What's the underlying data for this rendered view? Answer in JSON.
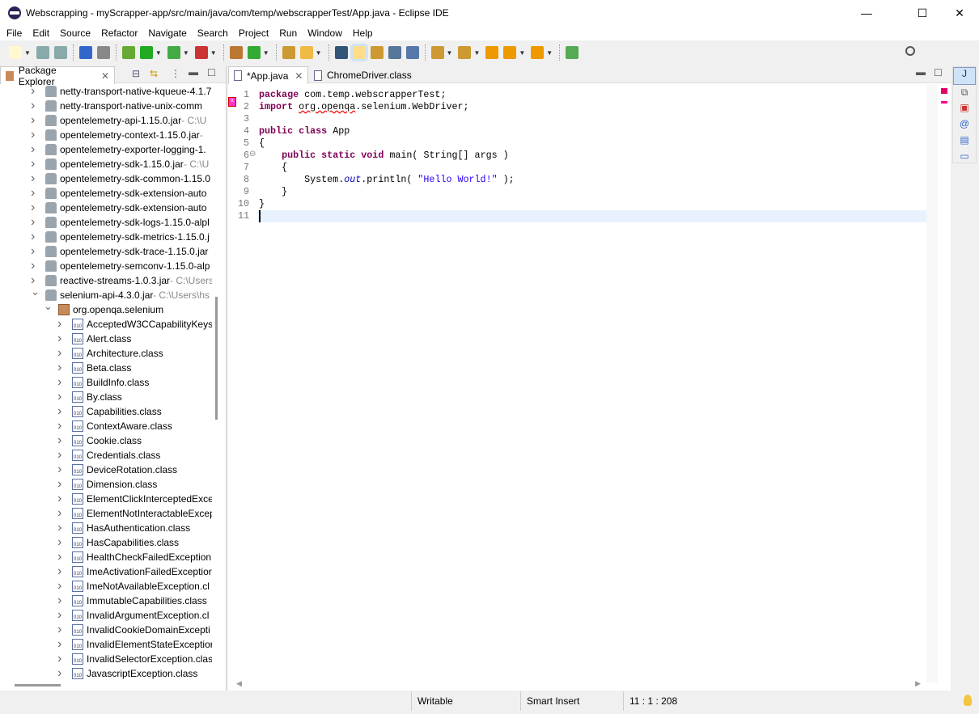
{
  "window": {
    "title": "Webscrapping - myScrapper-app/src/main/java/com/temp/webscrapperTest/App.java - Eclipse IDE",
    "minimize": "—",
    "maximize": "☐",
    "close": "✕"
  },
  "menu": [
    "File",
    "Edit",
    "Source",
    "Refactor",
    "Navigate",
    "Search",
    "Project",
    "Run",
    "Window",
    "Help"
  ],
  "toolbar": {
    "icons": [
      "new-icon",
      "save-icon",
      "save-all-icon",
      "terminal-icon",
      "skip-breakpoints-icon",
      "debug-icon",
      "run-icon",
      "coverage-icon",
      "external-tools-icon",
      "new-java-package-icon",
      "new-java-class-icon",
      "open-type-icon",
      "search-icon",
      "toggle-breadcrumb-icon",
      "mark-occurrences-icon",
      "block-selection-icon",
      "word-wrap-icon",
      "show-whitespace-icon",
      "next-annotation-icon",
      "previous-annotation-icon",
      "last-edit-location-icon",
      "back-icon",
      "forward-icon",
      "pin-editor-icon"
    ]
  },
  "package_explorer": {
    "title": "Package Explorer",
    "tree": [
      {
        "label": "netty-transport-native-kqueue-4.1.7",
        "decoration": "",
        "level": 0,
        "expanded": false,
        "kind": "jar"
      },
      {
        "label": "netty-transport-native-unix-comm",
        "decoration": "",
        "level": 0,
        "expanded": false,
        "kind": "jar"
      },
      {
        "label": "opentelemetry-api-1.15.0.jar",
        "decoration": " - C:\\U",
        "level": 0,
        "expanded": false,
        "kind": "jar"
      },
      {
        "label": "opentelemetry-context-1.15.0.jar",
        "decoration": " - ",
        "level": 0,
        "expanded": false,
        "kind": "jar"
      },
      {
        "label": "opentelemetry-exporter-logging-1.",
        "decoration": "",
        "level": 0,
        "expanded": false,
        "kind": "jar"
      },
      {
        "label": "opentelemetry-sdk-1.15.0.jar",
        "decoration": " - C:\\U",
        "level": 0,
        "expanded": false,
        "kind": "jar"
      },
      {
        "label": "opentelemetry-sdk-common-1.15.0",
        "decoration": "",
        "level": 0,
        "expanded": false,
        "kind": "jar"
      },
      {
        "label": "opentelemetry-sdk-extension-auto",
        "decoration": "",
        "level": 0,
        "expanded": false,
        "kind": "jar"
      },
      {
        "label": "opentelemetry-sdk-extension-auto",
        "decoration": "",
        "level": 0,
        "expanded": false,
        "kind": "jar"
      },
      {
        "label": "opentelemetry-sdk-logs-1.15.0-alpl",
        "decoration": "",
        "level": 0,
        "expanded": false,
        "kind": "jar"
      },
      {
        "label": "opentelemetry-sdk-metrics-1.15.0.j",
        "decoration": "",
        "level": 0,
        "expanded": false,
        "kind": "jar"
      },
      {
        "label": "opentelemetry-sdk-trace-1.15.0.jar",
        "decoration": "",
        "level": 0,
        "expanded": false,
        "kind": "jar"
      },
      {
        "label": "opentelemetry-semconv-1.15.0-alp",
        "decoration": "",
        "level": 0,
        "expanded": false,
        "kind": "jar"
      },
      {
        "label": "reactive-streams-1.0.3.jar",
        "decoration": " - C:\\Users",
        "level": 0,
        "expanded": false,
        "kind": "jar"
      },
      {
        "label": "selenium-api-4.3.0.jar",
        "decoration": " - C:\\Users\\hs",
        "level": 0,
        "expanded": true,
        "kind": "jar"
      },
      {
        "label": "org.openqa.selenium",
        "decoration": "",
        "level": 1,
        "expanded": true,
        "kind": "package"
      },
      {
        "label": "AcceptedW3CCapabilityKeys",
        "decoration": "",
        "level": 2,
        "expanded": false,
        "kind": "class"
      },
      {
        "label": "Alert.class",
        "decoration": "",
        "level": 2,
        "expanded": false,
        "kind": "class"
      },
      {
        "label": "Architecture.class",
        "decoration": "",
        "level": 2,
        "expanded": false,
        "kind": "class"
      },
      {
        "label": "Beta.class",
        "decoration": "",
        "level": 2,
        "expanded": false,
        "kind": "class"
      },
      {
        "label": "BuildInfo.class",
        "decoration": "",
        "level": 2,
        "expanded": false,
        "kind": "class"
      },
      {
        "label": "By.class",
        "decoration": "",
        "level": 2,
        "expanded": false,
        "kind": "class"
      },
      {
        "label": "Capabilities.class",
        "decoration": "",
        "level": 2,
        "expanded": false,
        "kind": "class"
      },
      {
        "label": "ContextAware.class",
        "decoration": "",
        "level": 2,
        "expanded": false,
        "kind": "class"
      },
      {
        "label": "Cookie.class",
        "decoration": "",
        "level": 2,
        "expanded": false,
        "kind": "class"
      },
      {
        "label": "Credentials.class",
        "decoration": "",
        "level": 2,
        "expanded": false,
        "kind": "class"
      },
      {
        "label": "DeviceRotation.class",
        "decoration": "",
        "level": 2,
        "expanded": false,
        "kind": "class"
      },
      {
        "label": "Dimension.class",
        "decoration": "",
        "level": 2,
        "expanded": false,
        "kind": "class"
      },
      {
        "label": "ElementClickInterceptedExce",
        "decoration": "",
        "level": 2,
        "expanded": false,
        "kind": "class"
      },
      {
        "label": "ElementNotInteractableExcep",
        "decoration": "",
        "level": 2,
        "expanded": false,
        "kind": "class"
      },
      {
        "label": "HasAuthentication.class",
        "decoration": "",
        "level": 2,
        "expanded": false,
        "kind": "class"
      },
      {
        "label": "HasCapabilities.class",
        "decoration": "",
        "level": 2,
        "expanded": false,
        "kind": "class"
      },
      {
        "label": "HealthCheckFailedException.",
        "decoration": "",
        "level": 2,
        "expanded": false,
        "kind": "class"
      },
      {
        "label": "ImeActivationFailedExceptior",
        "decoration": "",
        "level": 2,
        "expanded": false,
        "kind": "class"
      },
      {
        "label": "ImeNotAvailableException.cl",
        "decoration": "",
        "level": 2,
        "expanded": false,
        "kind": "class"
      },
      {
        "label": "ImmutableCapabilities.class",
        "decoration": "",
        "level": 2,
        "expanded": false,
        "kind": "class"
      },
      {
        "label": "InvalidArgumentException.cl",
        "decoration": "",
        "level": 2,
        "expanded": false,
        "kind": "class"
      },
      {
        "label": "InvalidCookieDomainExcepti",
        "decoration": "",
        "level": 2,
        "expanded": false,
        "kind": "class"
      },
      {
        "label": "InvalidElementStateExceptior",
        "decoration": "",
        "level": 2,
        "expanded": false,
        "kind": "class"
      },
      {
        "label": "InvalidSelectorException.clas",
        "decoration": "",
        "level": 2,
        "expanded": false,
        "kind": "class"
      },
      {
        "label": "JavascriptException.class",
        "decoration": "",
        "level": 2,
        "expanded": false,
        "kind": "class"
      }
    ]
  },
  "editor": {
    "tabs": [
      {
        "label": "*App.java",
        "active": true
      },
      {
        "label": "ChromeDriver.class",
        "active": false
      }
    ],
    "current_line": 11,
    "lines": [
      [
        {
          "t": "package",
          "c": "kw"
        },
        {
          "t": " com.temp.webscrapperTest;"
        }
      ],
      [
        {
          "t": "import",
          "c": "kw"
        },
        {
          "t": " "
        },
        {
          "t": "org.openqa",
          "c": "err"
        },
        {
          "t": ".selenium.WebDriver;"
        }
      ],
      [],
      [
        {
          "t": "public",
          "c": "kw"
        },
        {
          "t": " "
        },
        {
          "t": "class",
          "c": "kw"
        },
        {
          "t": " App"
        }
      ],
      [
        {
          "t": "{"
        }
      ],
      [
        {
          "t": "    "
        },
        {
          "t": "public",
          "c": "kw"
        },
        {
          "t": " "
        },
        {
          "t": "static",
          "c": "kw"
        },
        {
          "t": " "
        },
        {
          "t": "void",
          "c": "kw"
        },
        {
          "t": " main( String[] args )"
        }
      ],
      [
        {
          "t": "    {"
        }
      ],
      [
        {
          "t": "        System."
        },
        {
          "t": "out",
          "c": "fd"
        },
        {
          "t": ".println( "
        },
        {
          "t": "\"Hello World!\"",
          "c": "st"
        },
        {
          "t": " );"
        }
      ],
      [
        {
          "t": "    }"
        }
      ],
      [
        {
          "t": "}"
        }
      ],
      []
    ]
  },
  "status": {
    "mode": "Writable",
    "insert": "Smart Insert",
    "position": "11 : 1 : 208"
  },
  "colors": {
    "keyword": "#7f0055",
    "string": "#2a00ff",
    "field": "#0000c0",
    "current_line": "#e8f2fe"
  }
}
